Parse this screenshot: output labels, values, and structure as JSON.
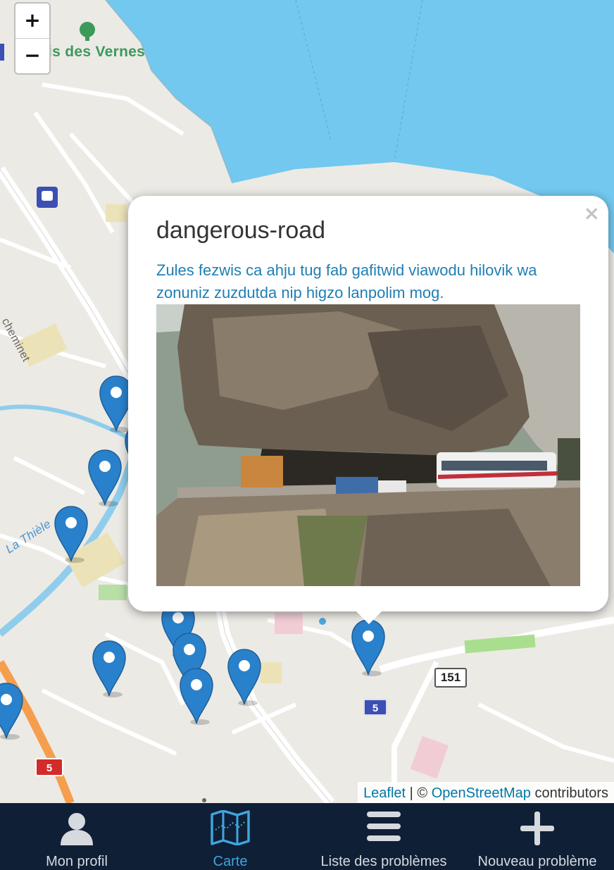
{
  "map": {
    "zoom_in_label": "+",
    "zoom_out_label": "−",
    "place_label": "is des Vernes",
    "river_label": "La Thièle",
    "street_label": "cheminet",
    "route_shields": [
      "151",
      "5",
      "5"
    ]
  },
  "popup": {
    "title": "dangerous-road",
    "description": "Zules fezwis ca ahju tug fab gafitwid viawodu hilovik wa zonuniz zuzdutda nip higzo lanpolim mog.",
    "close_label": "×"
  },
  "attribution": {
    "leaflet": "Leaflet",
    "separator": " | © ",
    "osm": "OpenStreetMap",
    "suffix": " contributors"
  },
  "tabs": [
    {
      "label": "Mon profil",
      "icon": "user-icon",
      "active": false
    },
    {
      "label": "Carte",
      "icon": "map-icon",
      "active": true
    },
    {
      "label": "Liste des problèmes",
      "icon": "list-icon",
      "active": false
    },
    {
      "label": "Nouveau problème",
      "icon": "plus-icon",
      "active": false
    }
  ],
  "colors": {
    "water": "#6ec6ee",
    "marker": "#2a81cb",
    "tab_active": "#3fa6dd",
    "tabbar_bg": "#0f1f36"
  }
}
